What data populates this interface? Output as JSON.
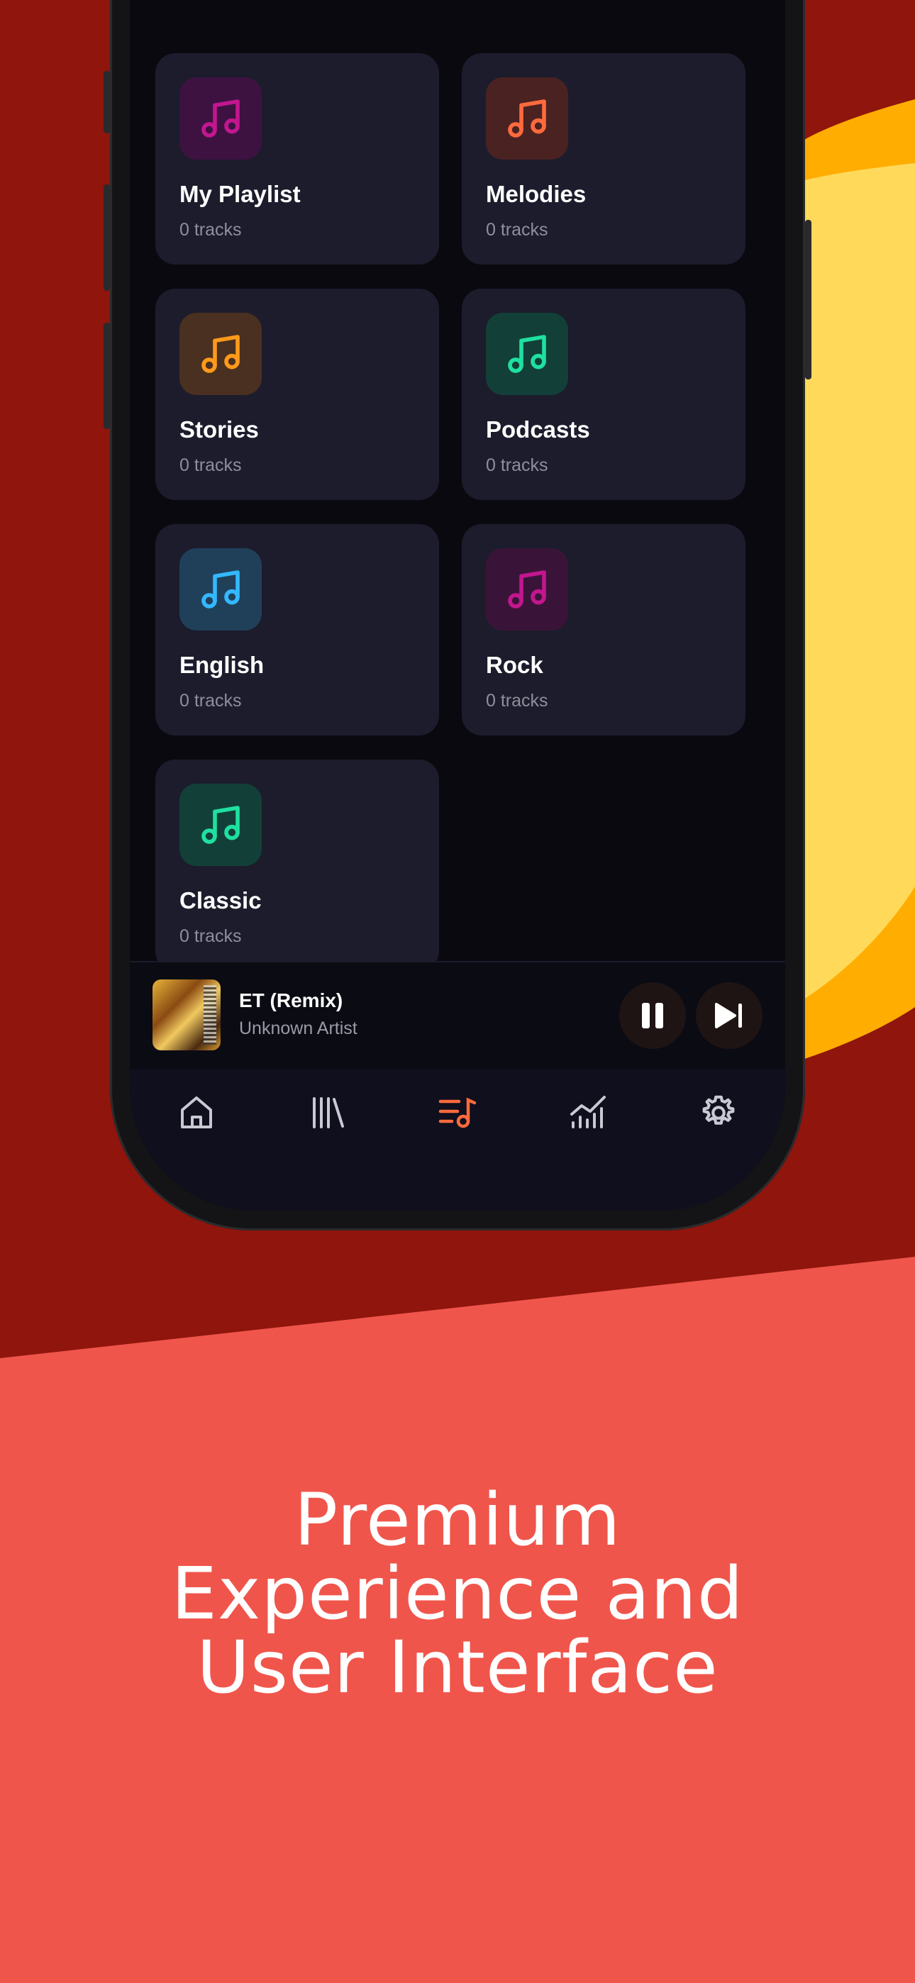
{
  "colors": {
    "background_dark_red": "#8f150d",
    "background_coral": "#f0554b",
    "accent_yellow": "#ffd95a",
    "accent_orange": "#ffad00",
    "app_background": "#09090f",
    "card_background": "#1c1c2c",
    "active_tab": "#ff6a3d"
  },
  "playlists": [
    {
      "name": "My Playlist",
      "count": "0 tracks",
      "icon": "music-note-icon",
      "color": "#c2168f",
      "tile": "#3d1240"
    },
    {
      "name": "Melodies",
      "count": "0 tracks",
      "icon": "music-note-icon",
      "color": "#ff6a3d",
      "tile": "#4a2222"
    },
    {
      "name": "Stories",
      "count": "0 tracks",
      "icon": "music-note-icon",
      "color": "#ff9a1a",
      "tile": "#4a3020"
    },
    {
      "name": "Podcasts",
      "count": "0 tracks",
      "icon": "music-note-icon",
      "color": "#1fe0a0",
      "tile": "#124038"
    },
    {
      "name": "English",
      "count": "0 tracks",
      "icon": "music-note-icon",
      "color": "#33b8ff",
      "tile": "#20405a"
    },
    {
      "name": "Rock",
      "count": "0 tracks",
      "icon": "music-note-icon",
      "color": "#c2168f",
      "tile": "#3a1438"
    },
    {
      "name": "Classic",
      "count": "0 tracks",
      "icon": "music-note-icon",
      "color": "#1fe0a0",
      "tile": "#124038"
    }
  ],
  "now_playing": {
    "title": "ET (Remix)",
    "artist": "Unknown Artist",
    "pause_icon": "pause-icon",
    "next_icon": "skip-next-icon"
  },
  "tabs": [
    {
      "name": "home",
      "icon": "home-icon",
      "active": false
    },
    {
      "name": "library",
      "icon": "library-icon",
      "active": false
    },
    {
      "name": "playlists",
      "icon": "playlist-icon",
      "active": true
    },
    {
      "name": "stats",
      "icon": "stats-icon",
      "active": false
    },
    {
      "name": "settings",
      "icon": "gear-icon",
      "active": false
    }
  ],
  "headline": {
    "line1": "Premium",
    "line2": "Experience and",
    "line3": "User Interface"
  }
}
